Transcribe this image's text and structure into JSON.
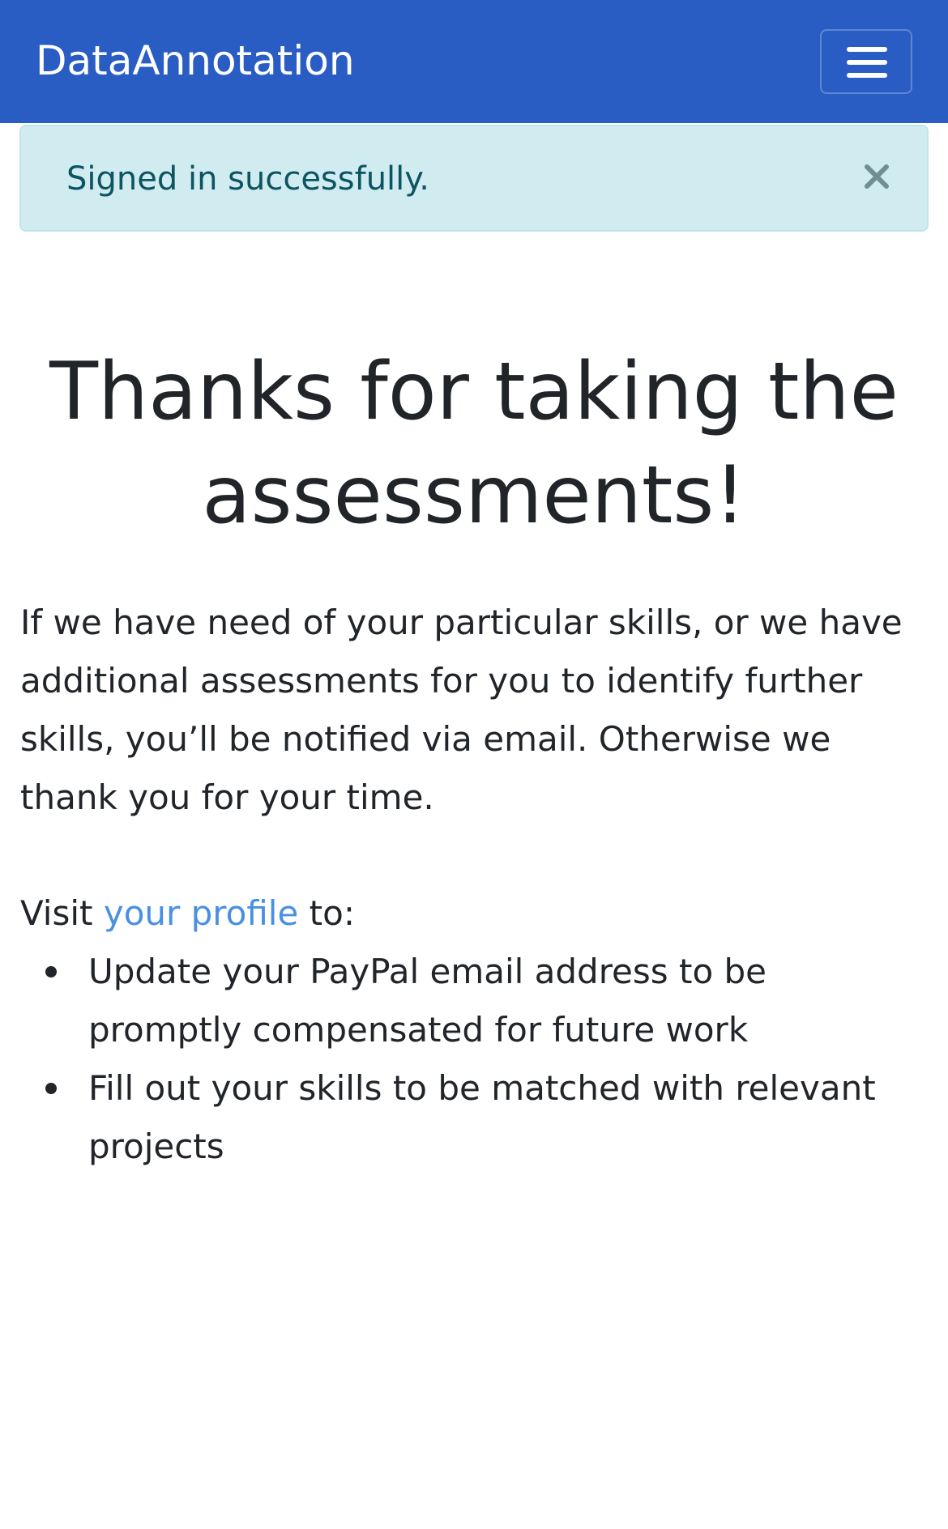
{
  "navbar": {
    "brand": "DataAnnotation",
    "background": "#2a5dc4",
    "menu_icon": "hamburger-menu-icon"
  },
  "alert": {
    "message": "Signed in successfully.",
    "close_icon": "close-icon",
    "background": "#d1ecf1",
    "text_color": "#0c5460"
  },
  "main": {
    "title": "Thanks for taking the assessments!",
    "paragraph": "If we have need of your particular skills, or we have additional assessments for you to identify further skills, you’ll be notified via email. Otherwise we thank you for your time.",
    "visit_prefix": "Visit ",
    "profile_link": "your profile",
    "visit_suffix": " to:",
    "link_color": "#4a90e2",
    "items": [
      "Update your PayPal email address to be promptly compensated for future work",
      "Fill out your skills to be matched with relevant projects"
    ]
  }
}
